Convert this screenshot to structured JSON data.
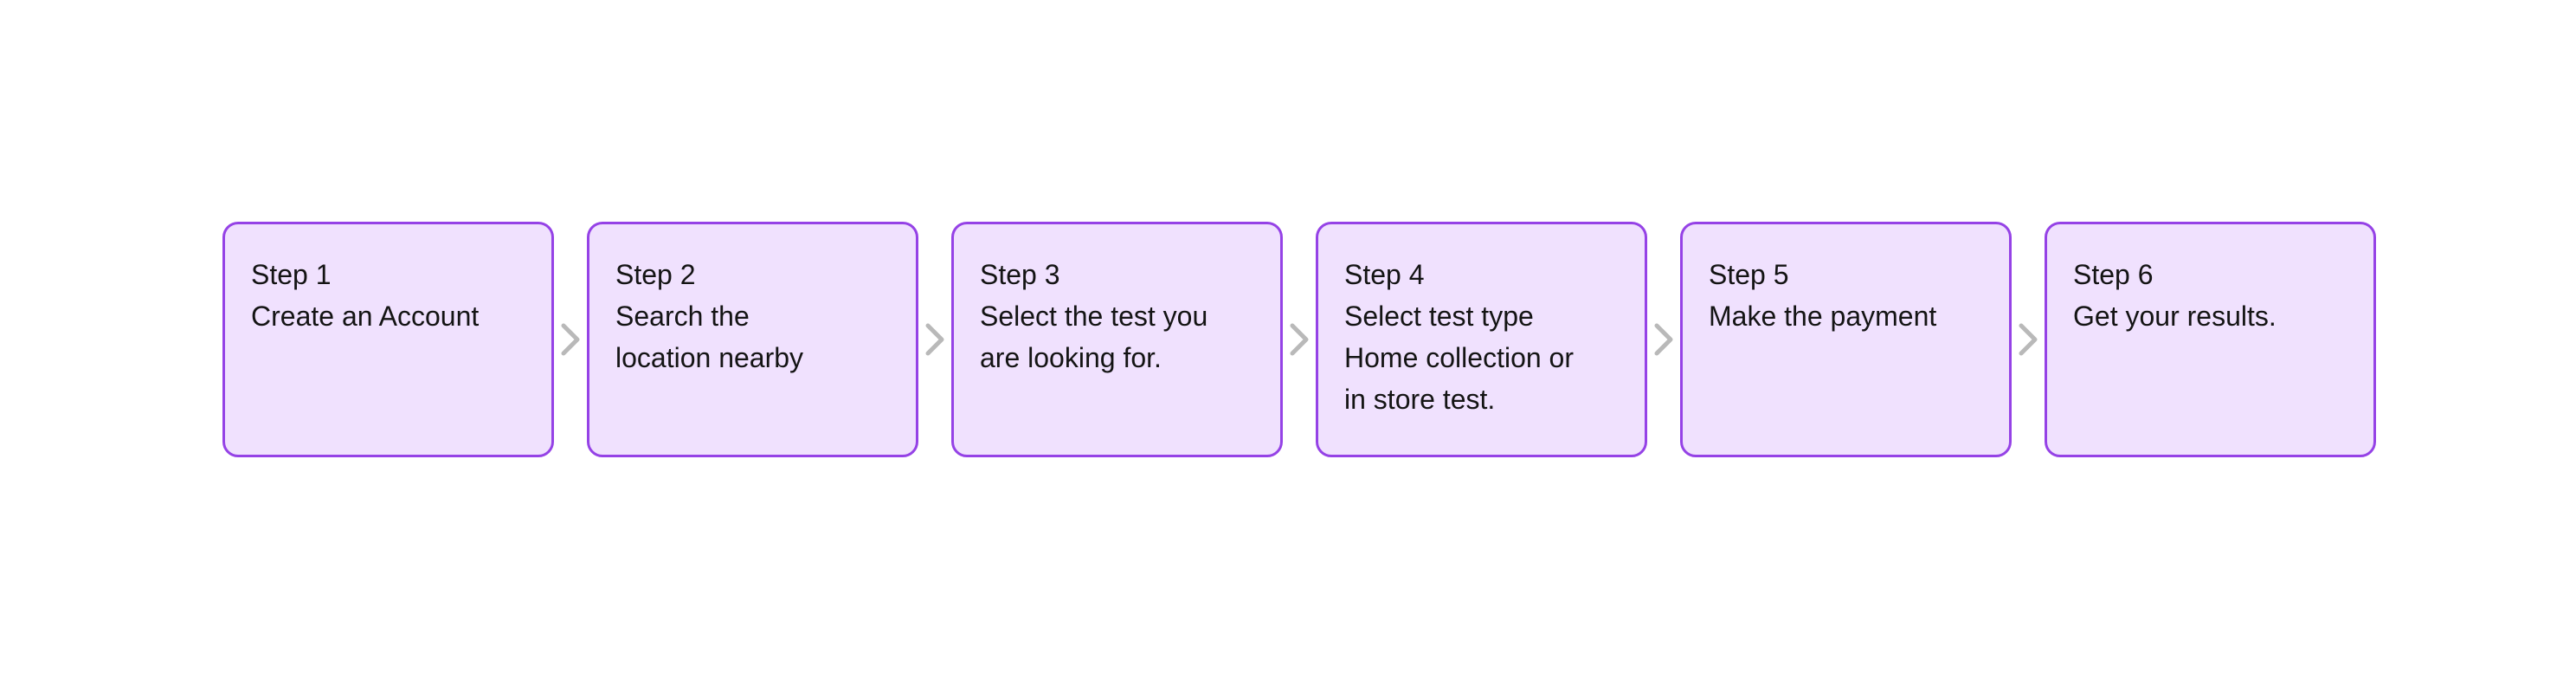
{
  "colors": {
    "box_fill": "#f0e1fe",
    "box_border": "#9542e6",
    "arrow": "#b9b9b9",
    "text": "#141414"
  },
  "steps": [
    {
      "title": "Step 1",
      "description": "Create an Account"
    },
    {
      "title": "Step 2",
      "description": "Search the\nlocation nearby"
    },
    {
      "title": "Step 3",
      "description": "Select the test you\nare looking for."
    },
    {
      "title": "Step 4",
      "description": "Select test type\nHome collection or\nin store test."
    },
    {
      "title": "Step 5",
      "description": "Make the payment"
    },
    {
      "title": "Step 6",
      "description": "Get your results."
    }
  ],
  "connector_icon": "chevron-right-icon"
}
